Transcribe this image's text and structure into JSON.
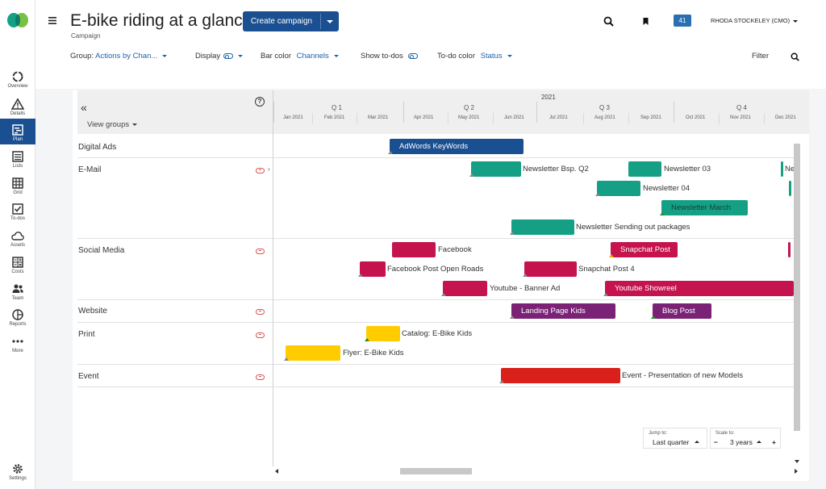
{
  "colors": {
    "navy": "#1a4f91",
    "teal": "#15a085",
    "crimson": "#c5134e",
    "purple": "#7a2276",
    "yellow": "#ffcc00",
    "red": "#d9201a",
    "accent_text": "#1f63ad"
  },
  "nav": {
    "items": [
      {
        "label": "Overview",
        "icon": "overview-icon"
      },
      {
        "label": "Details",
        "icon": "warning-icon"
      },
      {
        "label": "Plan",
        "icon": "plan-icon"
      },
      {
        "label": "Lists",
        "icon": "list-icon"
      },
      {
        "label": "Grid",
        "icon": "grid-icon"
      },
      {
        "label": "To-dos",
        "icon": "checkbox-icon"
      },
      {
        "label": "Assets",
        "icon": "cloud-icon"
      },
      {
        "label": "Costs",
        "icon": "calculator-icon"
      },
      {
        "label": "Team",
        "icon": "team-icon"
      },
      {
        "label": "Reports",
        "icon": "chart-icon"
      },
      {
        "label": "More",
        "icon": "more-icon"
      },
      {
        "label": "Settings",
        "icon": "gear-icon"
      }
    ],
    "active": "Plan"
  },
  "header": {
    "title": "E-bike riding at a glance",
    "subtitle": "Campaign",
    "create_label": "Create campaign",
    "badge": "41",
    "user": "RHODA STOCKELEY (CMO)"
  },
  "toolbar": {
    "group_label": "Group:",
    "group_value": "Actions by Chan...",
    "display_label": "Display",
    "barcolor_label": "Bar color",
    "barcolor_value": "Channels",
    "showtodos_label": "Show to-dos",
    "todocolor_label": "To-do color",
    "todocolor_value": "Status",
    "filter_label": "Filter"
  },
  "panel": {
    "view_groups": "View groups"
  },
  "timeline": {
    "year": "2021",
    "quarters": [
      "Q 1",
      "Q 2",
      "Q 3",
      "Q 4"
    ],
    "months": [
      "Jan 2021",
      "Feb 2021",
      "Mar 2021",
      "Apr 2021",
      "May 2021",
      "Jun 2021",
      "Jul 2021",
      "Aug 2021",
      "Sep 2021",
      "Oct 2021",
      "Nov 2021",
      "Dec 2021"
    ]
  },
  "groups": [
    {
      "label": "Digital Ads"
    },
    {
      "label": "E-Mail"
    },
    {
      "label": "Social Media"
    },
    {
      "label": "Website"
    },
    {
      "label": "Print"
    },
    {
      "label": "Event"
    }
  ],
  "bars": [
    {
      "label": "AdWords KeyWords",
      "color": "navy",
      "inside": true
    },
    {
      "label": "Newsletter Bsp. Q2",
      "color": "teal",
      "inside": false
    },
    {
      "label": "Newsletter 03",
      "color": "teal",
      "inside": false
    },
    {
      "label": "Ne",
      "color": "teal",
      "inside": false
    },
    {
      "label": "Newsletter 04",
      "color": "teal",
      "inside": false
    },
    {
      "label": "Newsletter March",
      "color": "teal",
      "inside": true
    },
    {
      "label": "Newsletter Sending out packages",
      "color": "teal",
      "inside": false
    },
    {
      "label": "Facebook",
      "color": "crimson",
      "inside": false
    },
    {
      "label": "Snapchat Post",
      "color": "crimson",
      "inside": true
    },
    {
      "label": "Facebook Post Open Roads",
      "color": "crimson",
      "inside": false
    },
    {
      "label": "Snapchat Post 4",
      "color": "crimson",
      "inside": false
    },
    {
      "label": "Youtube - Banner Ad",
      "color": "crimson",
      "inside": false
    },
    {
      "label": "Youtube Showreel",
      "color": "crimson",
      "inside": true
    },
    {
      "label": "Landing Page Kids",
      "color": "purple",
      "inside": true
    },
    {
      "label": "Blog Post",
      "color": "purple",
      "inside": true
    },
    {
      "label": "Catalog: E-Bike Kids",
      "color": "yellow",
      "inside": false
    },
    {
      "label": "Flyer: E-Bike Kids",
      "color": "yellow",
      "inside": false
    },
    {
      "label": "Event - Presentation of new Models",
      "color": "red",
      "inside": false
    }
  ],
  "controls": {
    "jump_caption": "Jump to:",
    "jump_value": "Last quarter",
    "scale_caption": "Scale to:",
    "scale_value": "3 years"
  }
}
